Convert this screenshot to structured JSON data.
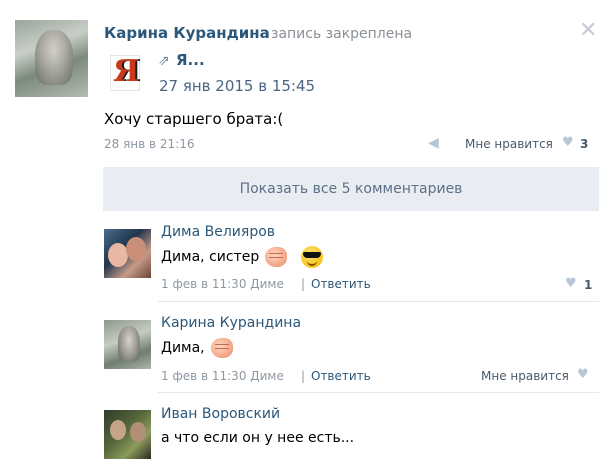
{
  "post": {
    "author": "Карина Курандина",
    "pinned_label": "запись закреплена",
    "close_glyph": "✕",
    "repost": {
      "icon": "share-arrow-icon",
      "title": "Я...",
      "date": "27 янв 2015 в 15:45"
    },
    "text": "Хочу старшего брата:(",
    "date": "28 янв в 21:16",
    "like_label": "Мне нравится",
    "like_count": "3"
  },
  "show_all_comments": "Показать все 5 комментариев",
  "comments": [
    {
      "author": "Дима Велияров",
      "text": "Дима, систер",
      "meta": "1 фев в 11:30 Диме",
      "separator": "|",
      "reply": "Ответить",
      "like_count": "1"
    },
    {
      "author": "Карина Курандина",
      "text": "Дима,",
      "meta": "1 фев в 11:30 Диме",
      "separator": "|",
      "reply": "Ответить",
      "like_label": "Мне нравится"
    },
    {
      "author": "Иван Воровский",
      "text": "а что если он у нее есть..."
    }
  ]
}
